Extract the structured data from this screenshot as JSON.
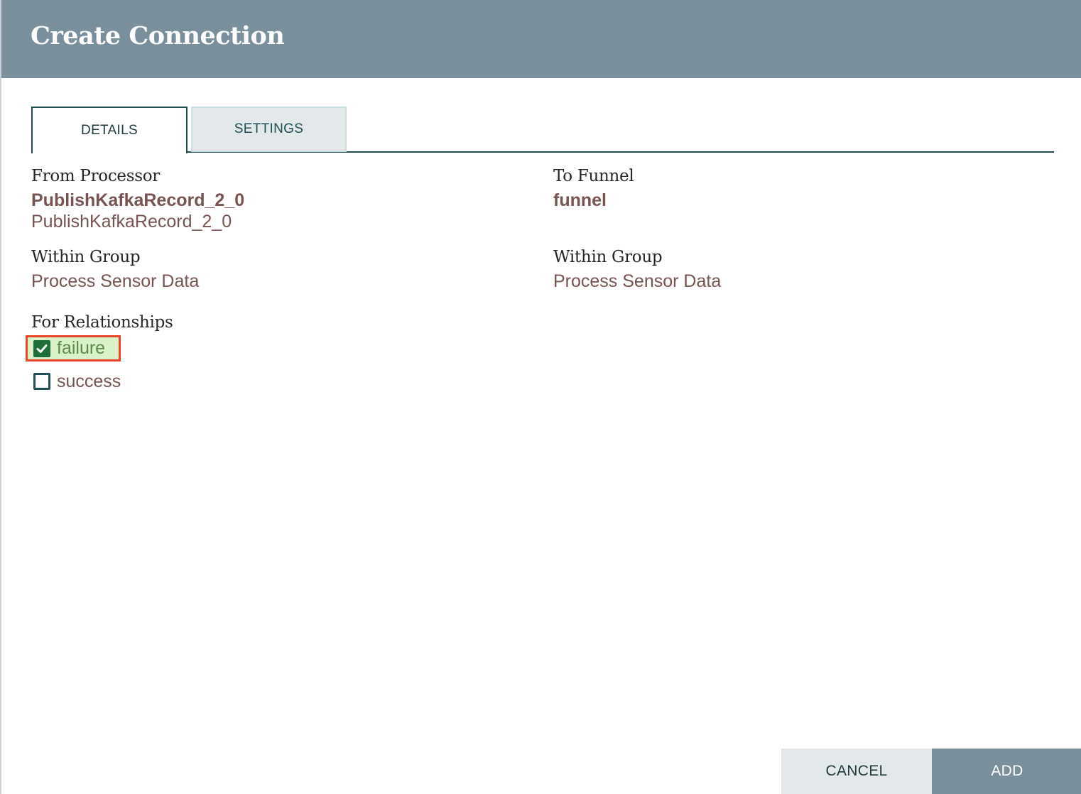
{
  "dialog": {
    "title": "Create Connection"
  },
  "tabs": [
    {
      "label": "DETAILS",
      "active": true
    },
    {
      "label": "SETTINGS",
      "active": false
    }
  ],
  "source": {
    "label": "From Processor",
    "name": "PublishKafkaRecord_2_0",
    "type": "PublishKafkaRecord_2_0",
    "group_label": "Within Group",
    "group": "Process Sensor Data"
  },
  "destination": {
    "label": "To Funnel",
    "name": "funnel",
    "group_label": "Within Group",
    "group": "Process Sensor Data"
  },
  "relationships": {
    "label": "For Relationships",
    "items": [
      {
        "label": "failure",
        "checked": true
      },
      {
        "label": "success",
        "checked": false
      }
    ]
  },
  "buttons": {
    "cancel": "CANCEL",
    "add": "ADD"
  },
  "colors": {
    "header": "#798f9b",
    "value_text": "#775351",
    "highlight": "#e8452c"
  }
}
